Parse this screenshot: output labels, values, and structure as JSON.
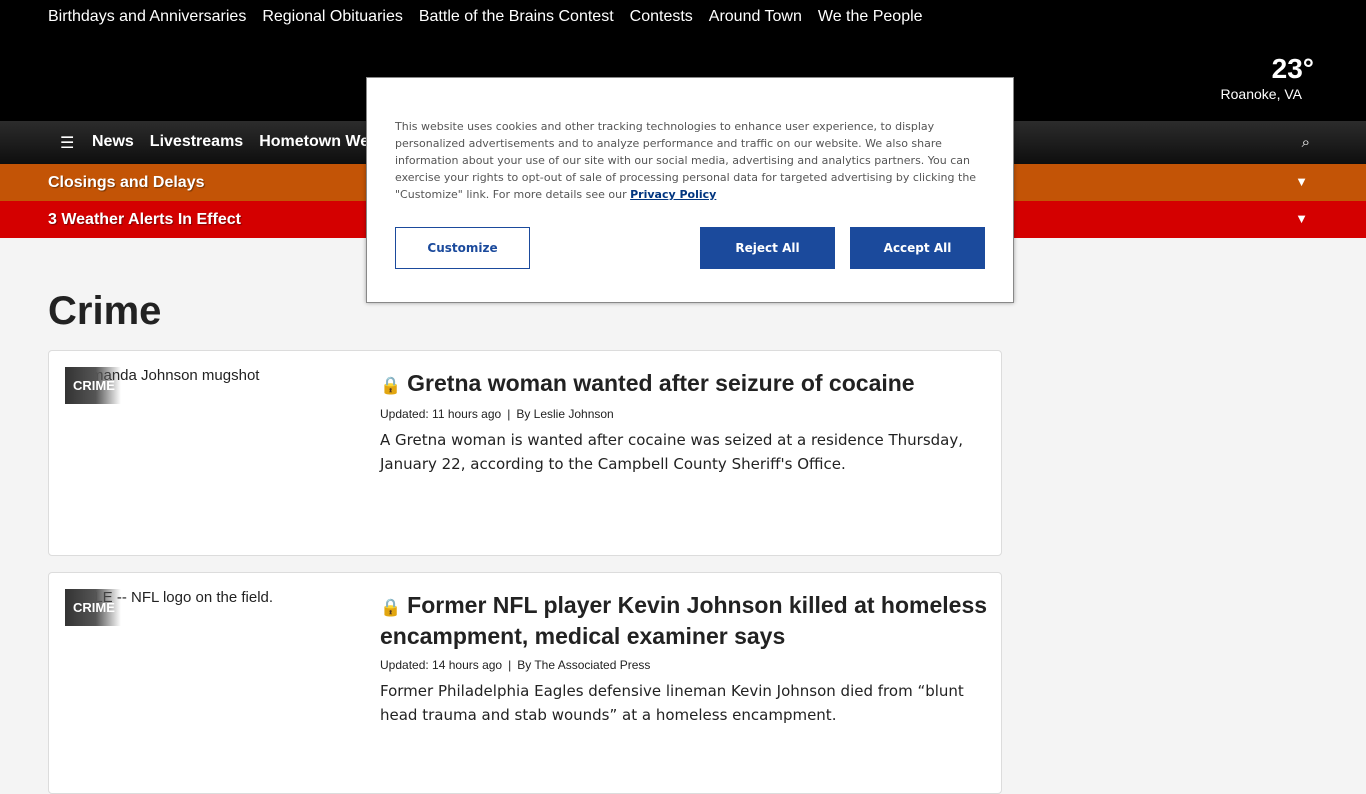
{
  "top_links": [
    "Birthdays and Anniversaries",
    "Regional Obituaries",
    "Battle of the Brains Contest",
    "Contests",
    "Around Town",
    "We the People"
  ],
  "weather": {
    "temperature": "23°",
    "location": "Roanoke, VA"
  },
  "main_nav": {
    "menu_icon": "hamburger-menu-icon",
    "items": [
      "News",
      "Livestreams",
      "Hometown We"
    ],
    "search_icon": "search-icon"
  },
  "closings_bar": {
    "label": "Closings and Delays",
    "icon": "chevron-down-icon",
    "color": "#c35406"
  },
  "alerts_bar": {
    "label": "3 Weather Alerts In Effect",
    "icon": "chevron-down-icon",
    "color": "#d40000"
  },
  "section_title": "Crime",
  "articles": [
    {
      "image_alt": "Amanda Johnson mugshot",
      "tag": "CRIME",
      "title": "Gretna woman wanted after seizure of cocaine",
      "updated": "Updated: 11 hours ago",
      "author": "By Leslie Johnson",
      "summary": "A Gretna woman is wanted after cocaine was seized at a residence Thursday, January 22, according to the Campbell County Sheriff's Office."
    },
    {
      "image_alt": "FILE -- NFL logo on the field.",
      "tag": "CRIME",
      "title": "Former NFL player Kevin Johnson killed at homeless encampment, medical examiner says",
      "updated": "Updated: 14 hours ago",
      "author": "By The Associated Press",
      "summary": "Former Philadelphia Eagles defensive lineman Kevin Johnson died from “blunt head trauma and stab wounds” at a homeless encampment."
    }
  ],
  "cookie_banner": {
    "text": "This website uses cookies and other tracking technologies to enhance user experience, to display personalized advertisements and to analyze performance and traffic on our website. We also share information about your use of our site with our social media, advertising and analytics partners. You can exercise your rights to opt-out of sale of processing personal data for targeted advertising by clicking the \"Customize\" link. For more details see our",
    "privacy_link": "Privacy Policy",
    "customize_label": "Customize",
    "reject_label": "Reject All",
    "accept_label": "Accept All",
    "button_color": "#1b4a9c"
  }
}
